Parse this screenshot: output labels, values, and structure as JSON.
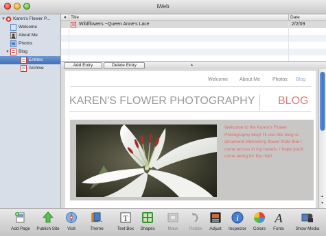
{
  "window": {
    "title": "iWeb"
  },
  "sidebar": {
    "site": "Karen's Flower P...",
    "items": [
      {
        "label": "Welcome"
      },
      {
        "label": "About Me"
      },
      {
        "label": "Photos"
      },
      {
        "label": "Blog"
      },
      {
        "label": "Entries"
      },
      {
        "label": "Archive"
      }
    ]
  },
  "entries": {
    "columns": {
      "marker": "●",
      "title": "Title",
      "date": "Date"
    },
    "rows": [
      {
        "title": "Wildflowers ~Queen Anne's Lace",
        "date": "2/2/09"
      }
    ]
  },
  "entry_buttons": {
    "add": "Add Entry",
    "delete": "Delete Entry",
    "grip": "▴"
  },
  "webpage": {
    "nav": [
      "Welcome",
      "About Me",
      "Photos",
      "Blog"
    ],
    "title": "KAREN'S FLOWER PHOTOGRAPHY",
    "section": "BLOG",
    "body": "Welcome to the Karen's Flower Photography blog! I'll use this blog to document interesting flower finds that I come across in my travels. I hope you'll come along for the ride!"
  },
  "toolbar": {
    "items": [
      {
        "label": "Add Page",
        "icon": "add-page-icon"
      },
      {
        "label": "Publish Site",
        "icon": "publish-icon"
      },
      {
        "label": "Visit",
        "icon": "visit-icon"
      },
      {
        "label": "Theme",
        "icon": "theme-icon"
      },
      {
        "label": "Text Box",
        "icon": "text-box-icon"
      },
      {
        "label": "Shapes",
        "icon": "shapes-icon"
      },
      {
        "label": "Mask",
        "icon": "mask-icon"
      },
      {
        "label": "Rotate",
        "icon": "rotate-icon"
      },
      {
        "label": "Adjust",
        "icon": "adjust-icon"
      },
      {
        "label": "Inspector",
        "icon": "inspector-icon"
      },
      {
        "label": "Colors",
        "icon": "colors-icon"
      },
      {
        "label": "Fonts",
        "icon": "fonts-icon"
      },
      {
        "label": "Show Media",
        "icon": "media-icon"
      }
    ]
  },
  "colors": {
    "accent": "#d57e78",
    "selection": "#416fb8",
    "nav_active": "#8aaed6"
  }
}
